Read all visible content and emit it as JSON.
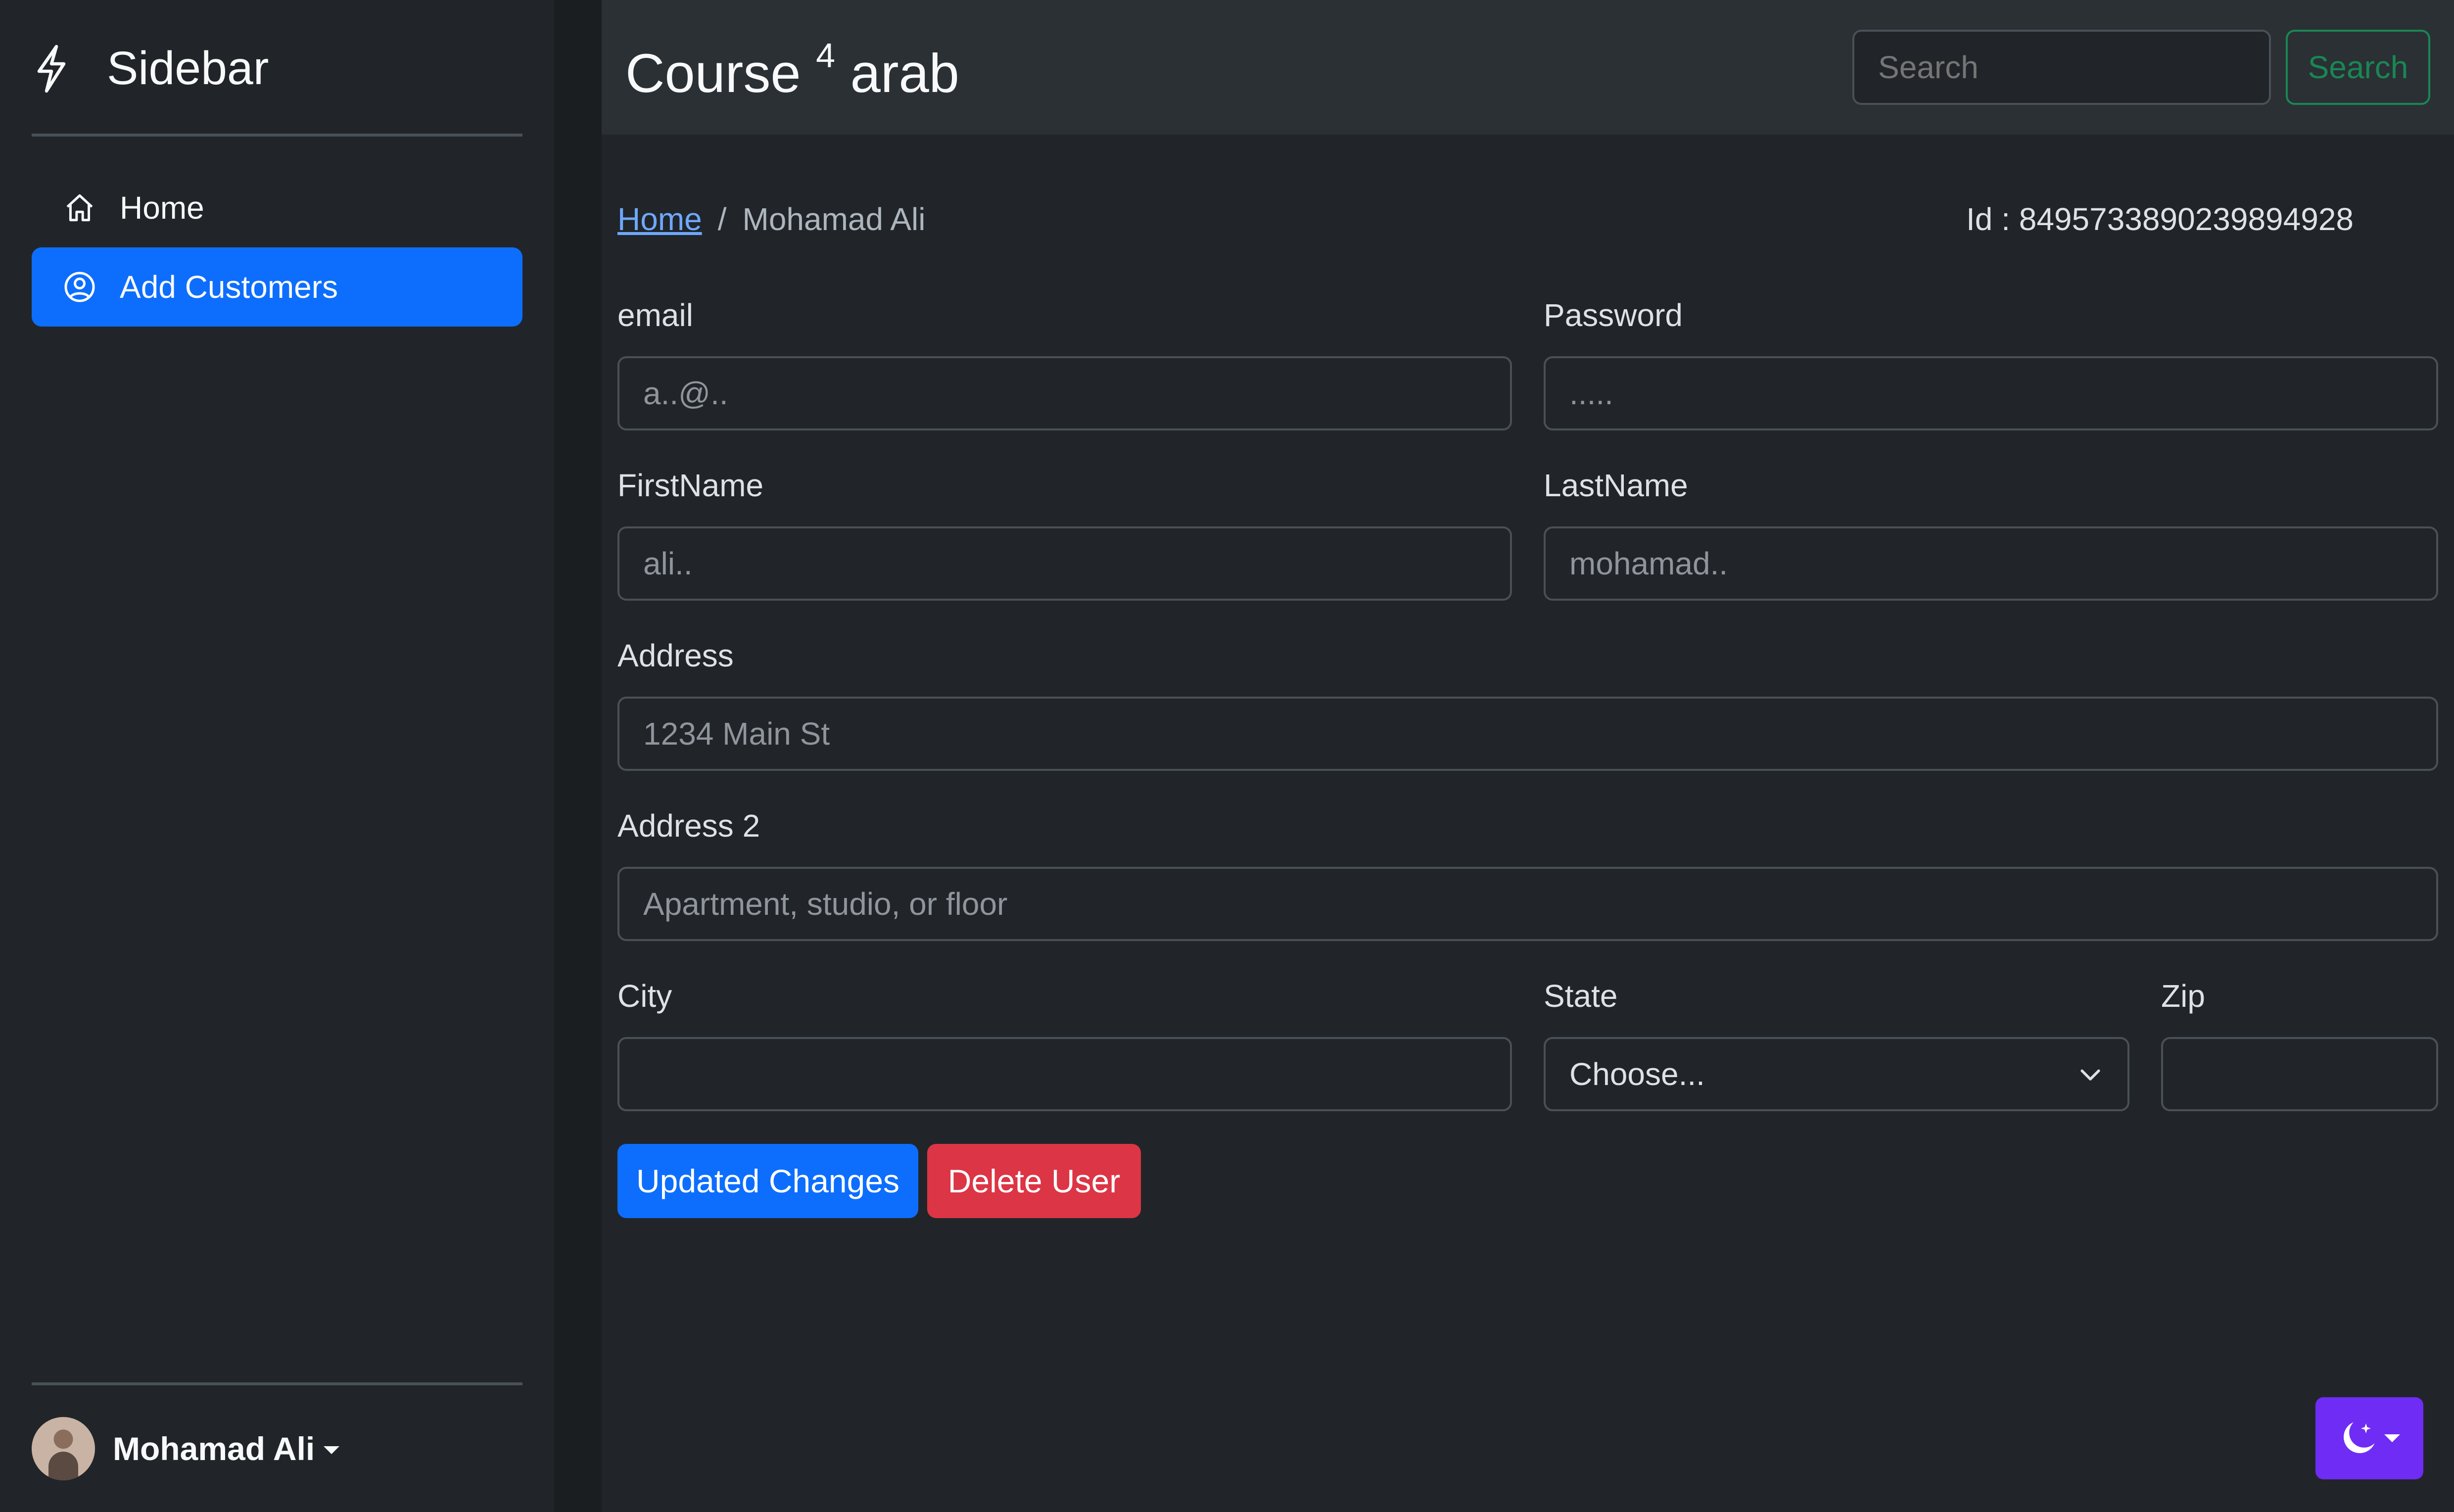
{
  "sidebar": {
    "brand": "Sidebar",
    "items": [
      {
        "label": "Home",
        "icon": "home-icon"
      },
      {
        "label": "Add Customers",
        "icon": "user-circle-icon"
      }
    ],
    "user": {
      "name": "Mohamad Ali"
    }
  },
  "header": {
    "title": "Course",
    "title_sup": "4",
    "title_suffix": "arab",
    "search": {
      "placeholder": "Search",
      "button_label": "Search"
    }
  },
  "breadcrumb": {
    "home": "Home",
    "separator": "/",
    "current": "Mohamad Ali"
  },
  "record_id": "Id : 8495733890239894928",
  "form": {
    "email": {
      "label": "email",
      "placeholder": "a..@.."
    },
    "password": {
      "label": "Password",
      "placeholder": "....."
    },
    "firstname": {
      "label": "FirstName",
      "placeholder": "ali.."
    },
    "lastname": {
      "label": "LastName",
      "placeholder": "mohamad.."
    },
    "address": {
      "label": "Address",
      "placeholder": "1234 Main St"
    },
    "address2": {
      "label": "Address 2",
      "placeholder": "Apartment, studio, or floor"
    },
    "city": {
      "label": "City",
      "placeholder": ""
    },
    "state": {
      "label": "State",
      "selected": "Choose..."
    },
    "zip": {
      "label": "Zip",
      "placeholder": ""
    }
  },
  "actions": {
    "update": "Updated Changes",
    "delete": "Delete User"
  },
  "colors": {
    "background": "#212529",
    "header": "#2b3035",
    "primary": "#0d6efd",
    "danger": "#dc3545",
    "success": "#198754",
    "theme_toggle": "#6f2cf5"
  }
}
